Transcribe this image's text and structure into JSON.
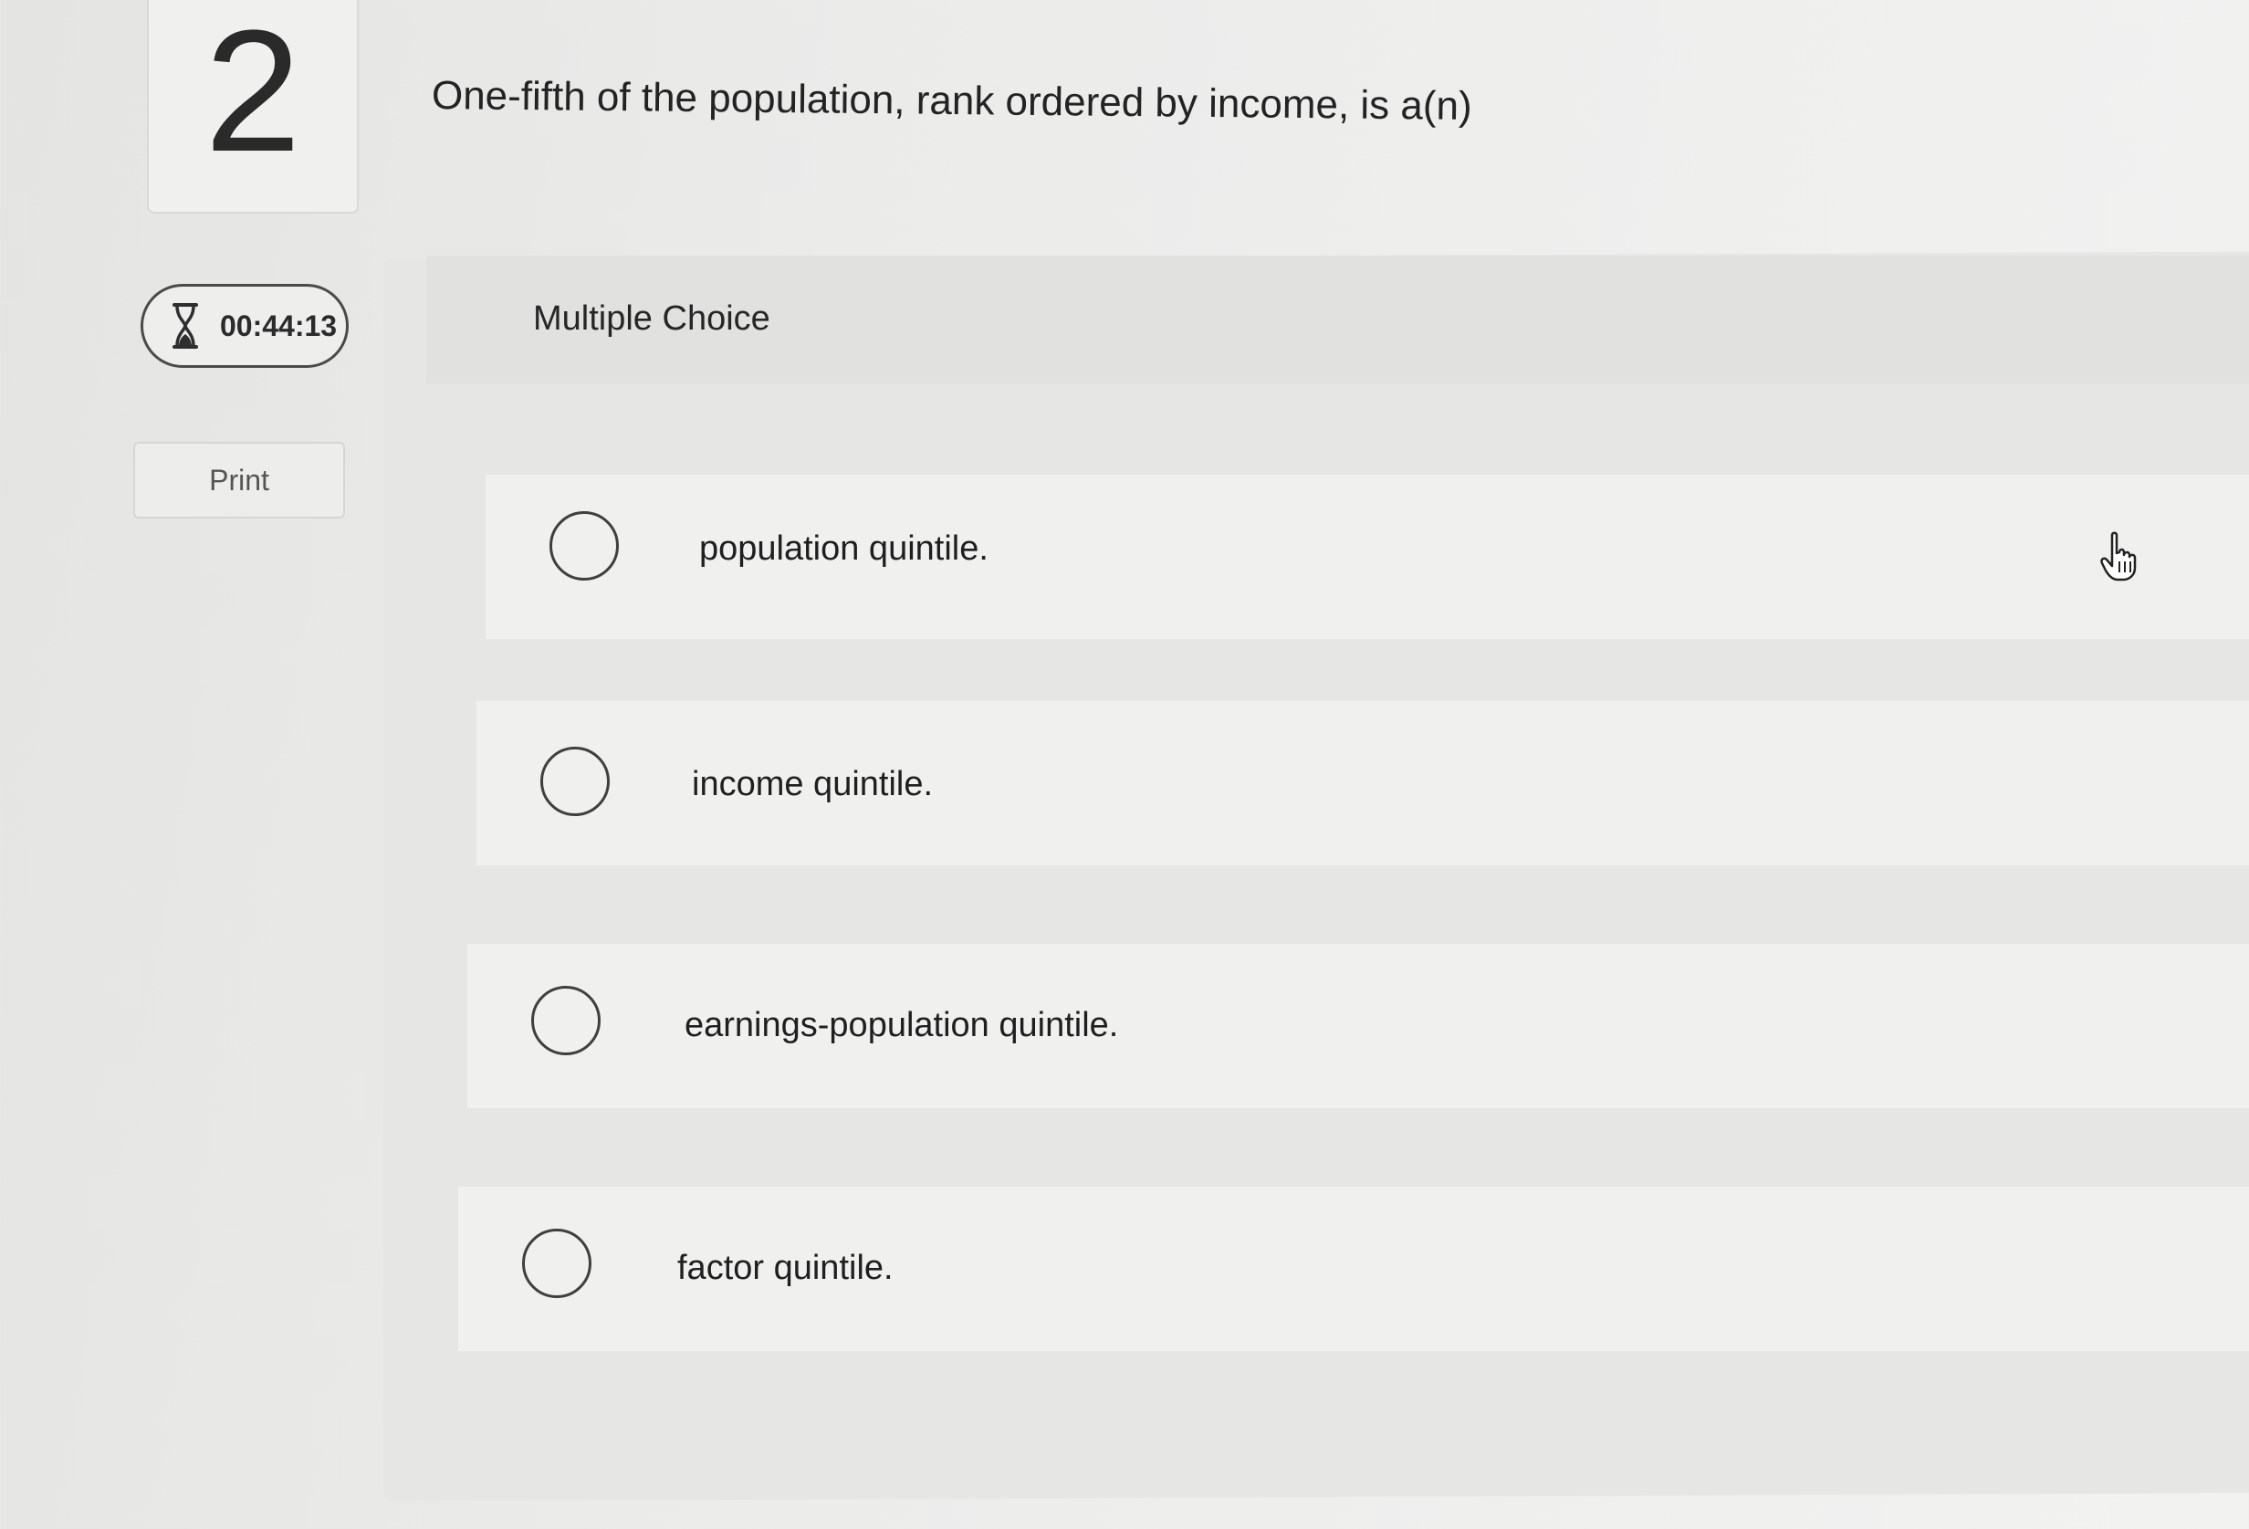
{
  "question": {
    "number": "2",
    "text": "One-fifth of the population, rank ordered by income, is a(n)"
  },
  "timer": {
    "icon": "hourglass-icon",
    "value": "00:44:13"
  },
  "print_button": {
    "label": "Print"
  },
  "answer_panel": {
    "type_label": "Multiple Choice",
    "options": [
      {
        "label": "population quintile.",
        "selected": false
      },
      {
        "label": "income quintile.",
        "selected": false
      },
      {
        "label": "earnings-population quintile.",
        "selected": false
      },
      {
        "label": "factor quintile.",
        "selected": false
      }
    ]
  },
  "cursor": {
    "icon": "hand-pointer-icon"
  }
}
